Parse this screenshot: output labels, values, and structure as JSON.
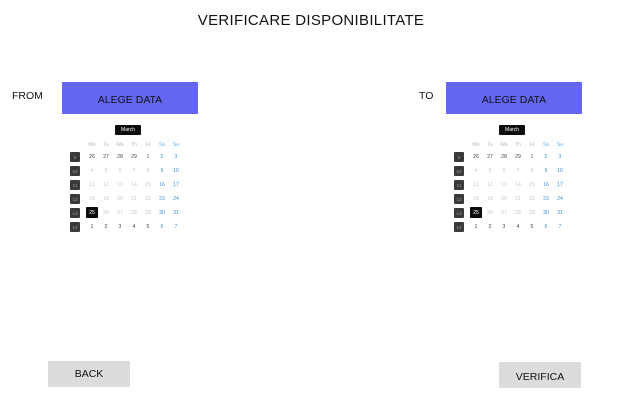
{
  "page": {
    "title": "VERIFICARE DISPONIBILITATE"
  },
  "from": {
    "label": "FROM",
    "button_label": "ALEGE DATA",
    "calendar": {
      "month": "March",
      "weekdays": [
        "Mo",
        "Tu",
        "We",
        "Th",
        "Fr",
        "Sa",
        "Su"
      ],
      "week_numbers": [
        "9",
        "10",
        "11",
        "12",
        "13",
        "14"
      ],
      "weeks": [
        [
          "26",
          "27",
          "28",
          "29",
          "1",
          "2",
          "3"
        ],
        [
          "4",
          "5",
          "6",
          "7",
          "8",
          "9",
          "10"
        ],
        [
          "11",
          "12",
          "13",
          "14",
          "15",
          "16",
          "17"
        ],
        [
          "18",
          "19",
          "20",
          "21",
          "22",
          "23",
          "24"
        ],
        [
          "25",
          "26",
          "27",
          "28",
          "29",
          "30",
          "31"
        ],
        [
          "1",
          "2",
          "3",
          "4",
          "5",
          "6",
          "7"
        ]
      ],
      "today": "25"
    }
  },
  "to": {
    "label": "TO",
    "button_label": "ALEGE DATA",
    "calendar": {
      "month": "March",
      "weekdays": [
        "Mo",
        "Tu",
        "We",
        "Th",
        "Fr",
        "Sa",
        "Su"
      ],
      "week_numbers": [
        "9",
        "10",
        "11",
        "12",
        "13",
        "14"
      ],
      "weeks": [
        [
          "26",
          "27",
          "28",
          "29",
          "1",
          "2",
          "3"
        ],
        [
          "4",
          "5",
          "6",
          "7",
          "8",
          "9",
          "10"
        ],
        [
          "11",
          "12",
          "13",
          "14",
          "15",
          "16",
          "17"
        ],
        [
          "18",
          "19",
          "20",
          "21",
          "22",
          "23",
          "24"
        ],
        [
          "25",
          "26",
          "27",
          "28",
          "29",
          "30",
          "31"
        ],
        [
          "1",
          "2",
          "3",
          "4",
          "5",
          "6",
          "7"
        ]
      ],
      "today": "25"
    }
  },
  "actions": {
    "back_label": "BACK",
    "verify_label": "VERIFICA"
  },
  "colors": {
    "accent": "#6366f1",
    "weekend": "#3b8fd9",
    "button_gray": "#dcdcdc"
  }
}
